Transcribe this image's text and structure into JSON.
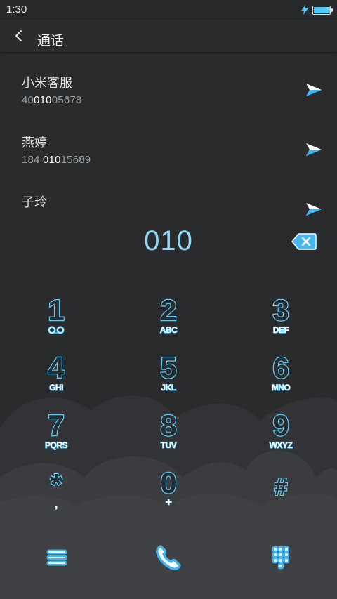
{
  "status": {
    "time": "1:30",
    "battery_level": 0.95,
    "charging_icon": "bolt-icon"
  },
  "header": {
    "title": "通话",
    "back_icon": "chevron-left-icon"
  },
  "contacts": [
    {
      "name": "小米客服",
      "number_parts": [
        "40",
        "010",
        "05678"
      ]
    },
    {
      "name": "燕婷",
      "number_parts": [
        "184 ",
        "010",
        "15689"
      ]
    },
    {
      "name": "子玲",
      "number_parts": [
        "",
        "",
        ""
      ]
    }
  ],
  "dial": {
    "value": "010"
  },
  "keys": [
    {
      "digit": "1",
      "letters": "",
      "sub_icon": "voicemail-icon"
    },
    {
      "digit": "2",
      "letters": "ABC"
    },
    {
      "digit": "3",
      "letters": "DEF"
    },
    {
      "digit": "4",
      "letters": "GHI"
    },
    {
      "digit": "5",
      "letters": "JKL"
    },
    {
      "digit": "6",
      "letters": "MNO"
    },
    {
      "digit": "7",
      "letters": "PQRS"
    },
    {
      "digit": "8",
      "letters": "TUV"
    },
    {
      "digit": "9",
      "letters": "WXYZ"
    },
    {
      "digit": "*",
      "letters": ","
    },
    {
      "digit": "0",
      "letters": "+"
    },
    {
      "digit": "#",
      "letters": ""
    }
  ],
  "bottom": {
    "menu_icon": "menu-icon",
    "call_icon": "phone-icon",
    "keypad_icon": "dialpad-icon"
  },
  "colors": {
    "accent": "#5cc9f5",
    "background": "#2a2b2d",
    "cloud": "#3d3f42"
  }
}
